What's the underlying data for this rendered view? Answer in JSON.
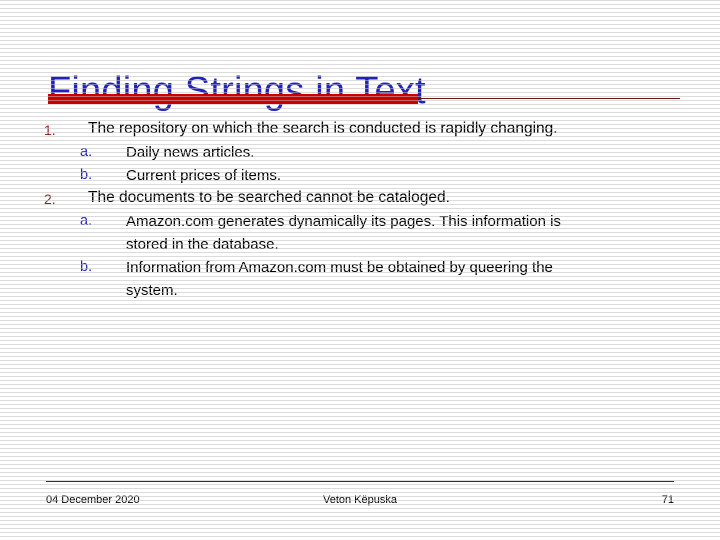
{
  "slide": {
    "title": "Finding Strings in Text",
    "title_color": "#2020C8",
    "accent_bar_color": "#CC0000",
    "accent_rule_color": "#6B1414",
    "background_color": "#FFFFFF"
  },
  "content": {
    "items": [
      {
        "marker": "1.",
        "marker_color": "#A02020",
        "text": "The repository on which the search is conducted is rapidly changing.",
        "subitems": [
          {
            "marker": "a.",
            "marker_color": "#2222CC",
            "text": "Daily news articles."
          },
          {
            "marker": "b.",
            "marker_color": "#2222CC",
            "text": "Current prices of items."
          }
        ]
      },
      {
        "marker": "2.",
        "marker_color": "#A02020",
        "text": "The documents to be searched cannot be cataloged.",
        "subitems": [
          {
            "marker": "a.",
            "marker_color": "#2222CC",
            "text": "Amazon.com generates dynamically its pages. This information is stored in the database."
          },
          {
            "marker": "b.",
            "marker_color": "#2222CC",
            "text": "Information from Amazon.com must be obtained by queering the system."
          }
        ]
      }
    ]
  },
  "footer": {
    "date": "04 December 2020",
    "author": "Veton Këpuska",
    "page_number": "71"
  }
}
